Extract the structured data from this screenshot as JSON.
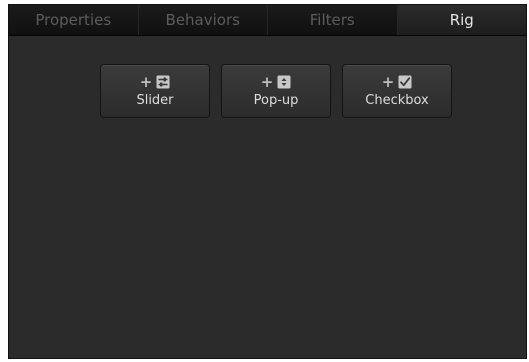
{
  "tabs": [
    {
      "label": "Properties",
      "active": false
    },
    {
      "label": "Behaviors",
      "active": false
    },
    {
      "label": "Filters",
      "active": false
    },
    {
      "label": "Rig",
      "active": true
    }
  ],
  "widgets": [
    {
      "plus": "+",
      "label": "Slider",
      "icon": "slider-icon"
    },
    {
      "plus": "+",
      "label": "Pop-up",
      "icon": "popup-icon"
    },
    {
      "plus": "+",
      "label": "Checkbox",
      "icon": "checkbox-icon"
    }
  ],
  "colors": {
    "panel": "#2b2b2b",
    "tabbar": "#101010",
    "active_tab_text": "#e4e4e4",
    "inactive_tab_text": "#5c5c5c"
  }
}
